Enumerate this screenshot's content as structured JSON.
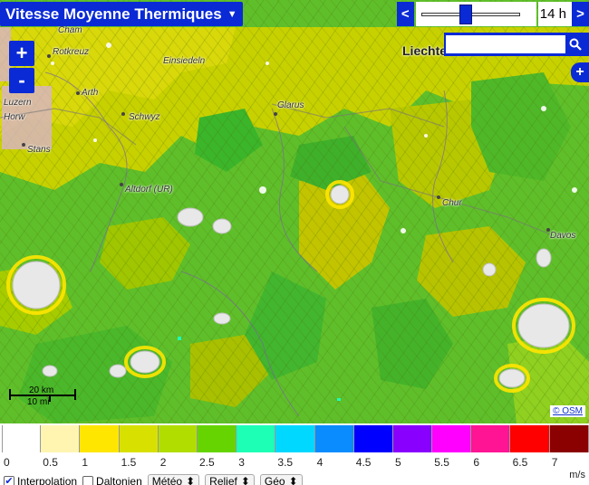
{
  "toolbar": {
    "title": "Vitesse Moyenne Thermiques",
    "prev_label": "<",
    "next_label": ">",
    "hour_label": "14 h",
    "hour_slider_fraction": 0.45
  },
  "search": {
    "placeholder": ""
  },
  "zoom": {
    "in_label": "+",
    "out_label": "-"
  },
  "layers": {
    "label": "+"
  },
  "map": {
    "places": [
      {
        "name": "Cham"
      },
      {
        "name": "Rotkreuz"
      },
      {
        "name": "Einsiedeln"
      },
      {
        "name": "Luzern"
      },
      {
        "name": "Horw"
      },
      {
        "name": "Arth"
      },
      {
        "name": "Schwyz"
      },
      {
        "name": "Glarus"
      },
      {
        "name": "Stans"
      },
      {
        "name": "Altdorf (UR)"
      },
      {
        "name": "Chur"
      },
      {
        "name": "Davos"
      },
      {
        "name": "Liechtenstein"
      }
    ],
    "scale": {
      "km": "20 km",
      "mi": "10 mi"
    },
    "attribution": "© OSM"
  },
  "legend": {
    "colors": [
      "#ffffff",
      "#fff5b0",
      "#ffe600",
      "#d8e000",
      "#b2dd00",
      "#66d400",
      "#1dffb5",
      "#00d8ff",
      "#0a8cff",
      "#0000ff",
      "#8a00ff",
      "#ff00ff",
      "#ff1493",
      "#ff0000",
      "#8b0000",
      "#000000"
    ],
    "ticks": [
      "0",
      "0.5",
      "1",
      "1.5",
      "2",
      "2.5",
      "3",
      "3.5",
      "4",
      "4.5",
      "5",
      "5.5",
      "6",
      "6.5",
      "7",
      "+"
    ],
    "unit": "m/s"
  },
  "controls": {
    "interpolation_label": "Interpolation",
    "interpolation_checked": true,
    "daltonien_label": "Daltonien",
    "daltonien_checked": false,
    "meteo_label": "Météo",
    "relief_label": "Relief",
    "geo_label": "Géo"
  }
}
